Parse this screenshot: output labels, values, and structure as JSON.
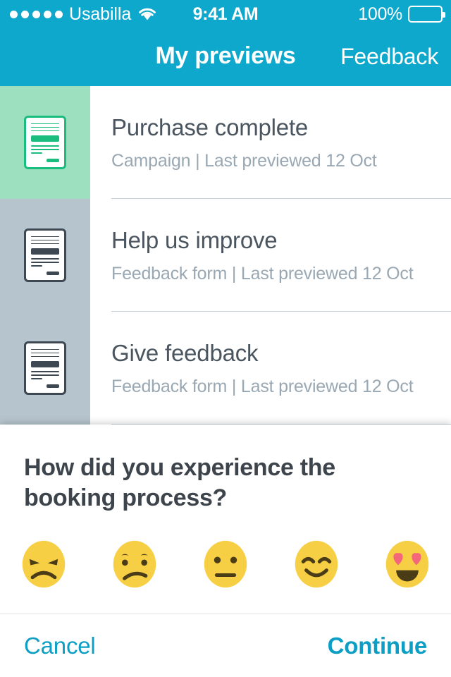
{
  "status_bar": {
    "signal_dots": 5,
    "carrier": "Usabilla",
    "wifi_icon": "wifi-icon",
    "time": "9:41 AM",
    "battery_percent": "100%",
    "battery_icon": "battery-full-icon"
  },
  "nav": {
    "title": "My previews",
    "action_label": "Feedback",
    "accent_color": "#0ea8cc"
  },
  "list": {
    "items": [
      {
        "title": "Purchase complete",
        "subtitle": "Campaign | Last previewed 12 Oct",
        "thumb_icon": "campaign-document-icon",
        "thumb_bg": "#9ce0c0",
        "thumb_fg": "#1bbd7e"
      },
      {
        "title": "Help us improve",
        "subtitle": "Feedback form | Last previewed 12 Oct",
        "thumb_icon": "feedback-form-document-icon",
        "thumb_bg": "#b6c4ce",
        "thumb_fg": "#3d4852"
      },
      {
        "title": "Give feedback",
        "subtitle": "Feedback form | Last previewed 12 Oct",
        "thumb_icon": "feedback-form-document-icon",
        "thumb_bg": "#b6c4ce",
        "thumb_fg": "#3d4852"
      }
    ]
  },
  "modal": {
    "question": "How did you experience the booking process?",
    "faces": [
      {
        "name": "angry-face-icon",
        "label": "Angry"
      },
      {
        "name": "sad-face-icon",
        "label": "Sad"
      },
      {
        "name": "neutral-face-icon",
        "label": "Neutral"
      },
      {
        "name": "happy-face-icon",
        "label": "Happy"
      },
      {
        "name": "heart-eyes-face-icon",
        "label": "Love"
      }
    ],
    "face_color": "#f7cf45",
    "face_feature_color": "#4a3c16",
    "heart_color": "#f4667a",
    "cancel_label": "Cancel",
    "continue_label": "Continue",
    "action_color": "#0c9ec4"
  }
}
